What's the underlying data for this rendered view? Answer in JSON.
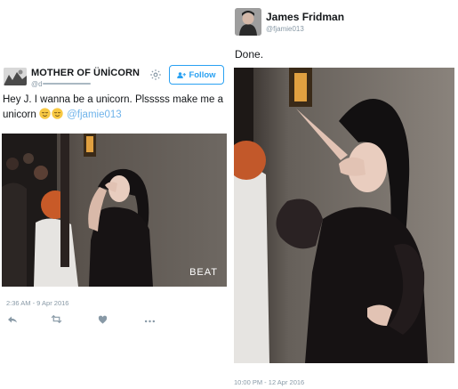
{
  "left_tweet": {
    "display_name": "MOTHER OF ÜNİCORN",
    "handle": "@d",
    "follow_label": "Follow",
    "text_main": "Hey J. I wanna be a unicorn. Plsssss make me a unicorn",
    "mention": "@fjamie013",
    "emojis": [
      "relieved-face",
      "relieved-face"
    ],
    "photo_watermark": "BEAT",
    "timestamp": "2:36 AM - 9 Apr 2016",
    "actions": [
      "reply-icon",
      "retweet-icon",
      "like-icon",
      "more-icon"
    ]
  },
  "right_tweet": {
    "display_name": "James Fridman",
    "handle": "@fjamie013",
    "text": "Done.",
    "timestamp": "10:00 PM - 12 Apr 2016"
  },
  "colors": {
    "accent": "#2aa1f2",
    "mention": "#6fb3ea",
    "muted": "#8899a6"
  }
}
